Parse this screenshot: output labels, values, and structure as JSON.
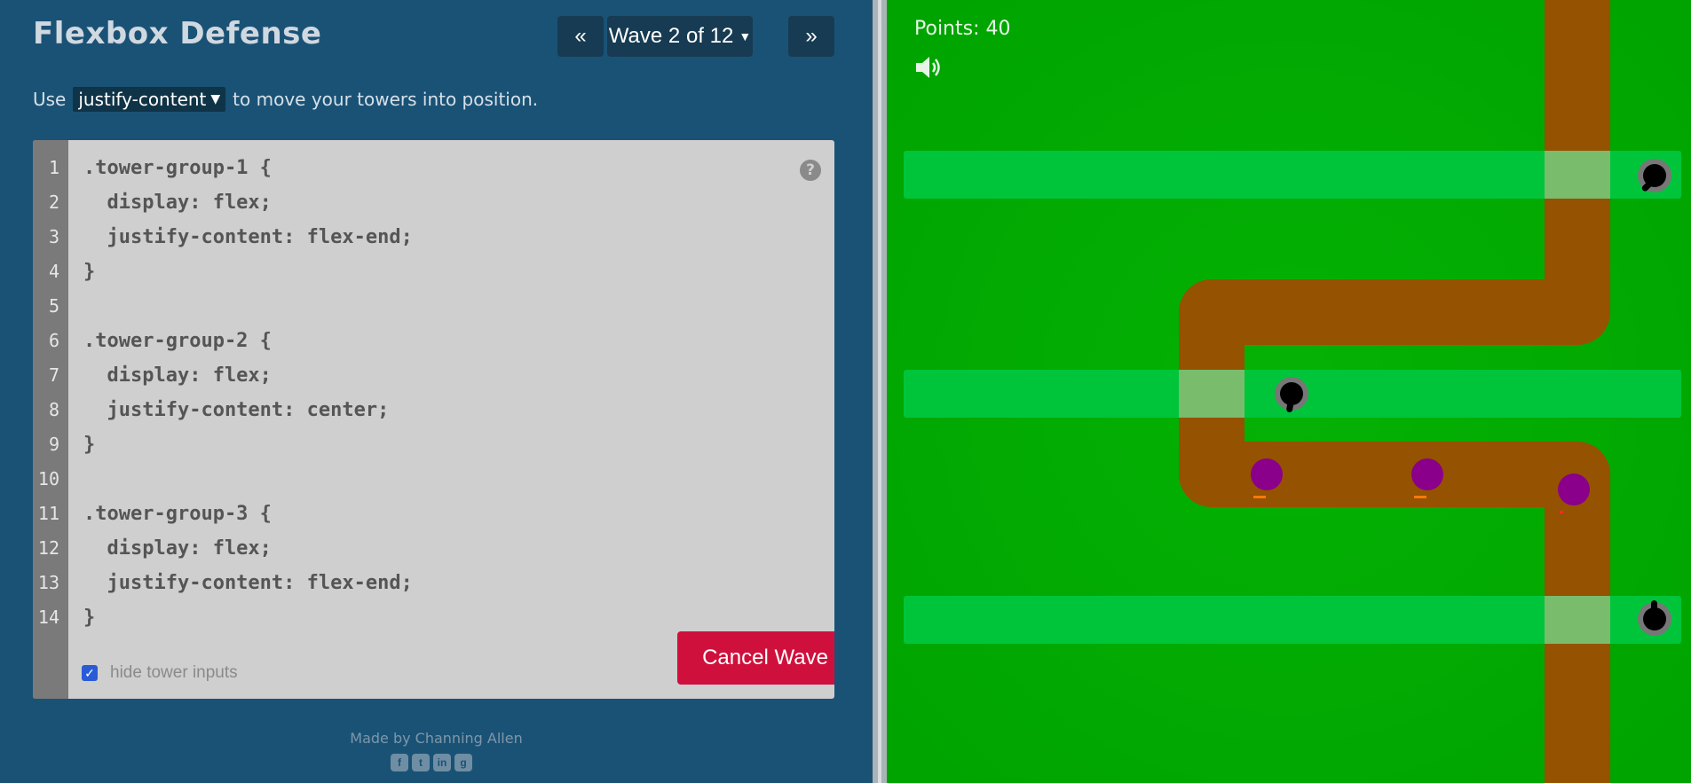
{
  "header": {
    "title": "Flexbox Defense",
    "prev_label": "«",
    "wave_label": "Wave 2 of 12",
    "next_label": "»"
  },
  "instructions": {
    "prefix": "Use",
    "property": "justify-content",
    "suffix": "to move your towers into position."
  },
  "editor": {
    "lines": [
      {
        "n": "1",
        "text": ".tower-group-1 {"
      },
      {
        "n": "2",
        "text": "  display: flex;"
      },
      {
        "n": "3",
        "text": "  justify-content: flex-end;"
      },
      {
        "n": "4",
        "text": "}"
      },
      {
        "n": "5",
        "text": ""
      },
      {
        "n": "6",
        "text": ".tower-group-2 {"
      },
      {
        "n": "7",
        "text": "  display: flex;"
      },
      {
        "n": "8",
        "text": "  justify-content: center;"
      },
      {
        "n": "9",
        "text": "}"
      },
      {
        "n": "10",
        "text": ""
      },
      {
        "n": "11",
        "text": ".tower-group-3 {"
      },
      {
        "n": "12",
        "text": "  display: flex;"
      },
      {
        "n": "13",
        "text": "  justify-content: flex-end;"
      },
      {
        "n": "14",
        "text": "}"
      }
    ],
    "help_label": "?",
    "hide_inputs_label": "hide tower inputs",
    "hide_inputs_checked": true,
    "cancel_label": "Cancel Wave"
  },
  "footer": {
    "credit": "Made by Channing Allen",
    "social_icons": [
      "facebook-icon",
      "twitter-icon",
      "linkedin-icon",
      "github-icon"
    ]
  },
  "game": {
    "points_label": "Points: 40",
    "sound_icon": "speaker-icon",
    "colors": {
      "grass": "#00a300",
      "lane": "#00c53a",
      "path": "#955200",
      "enemy": "#8a008a",
      "cancel": "#d0103c"
    }
  }
}
